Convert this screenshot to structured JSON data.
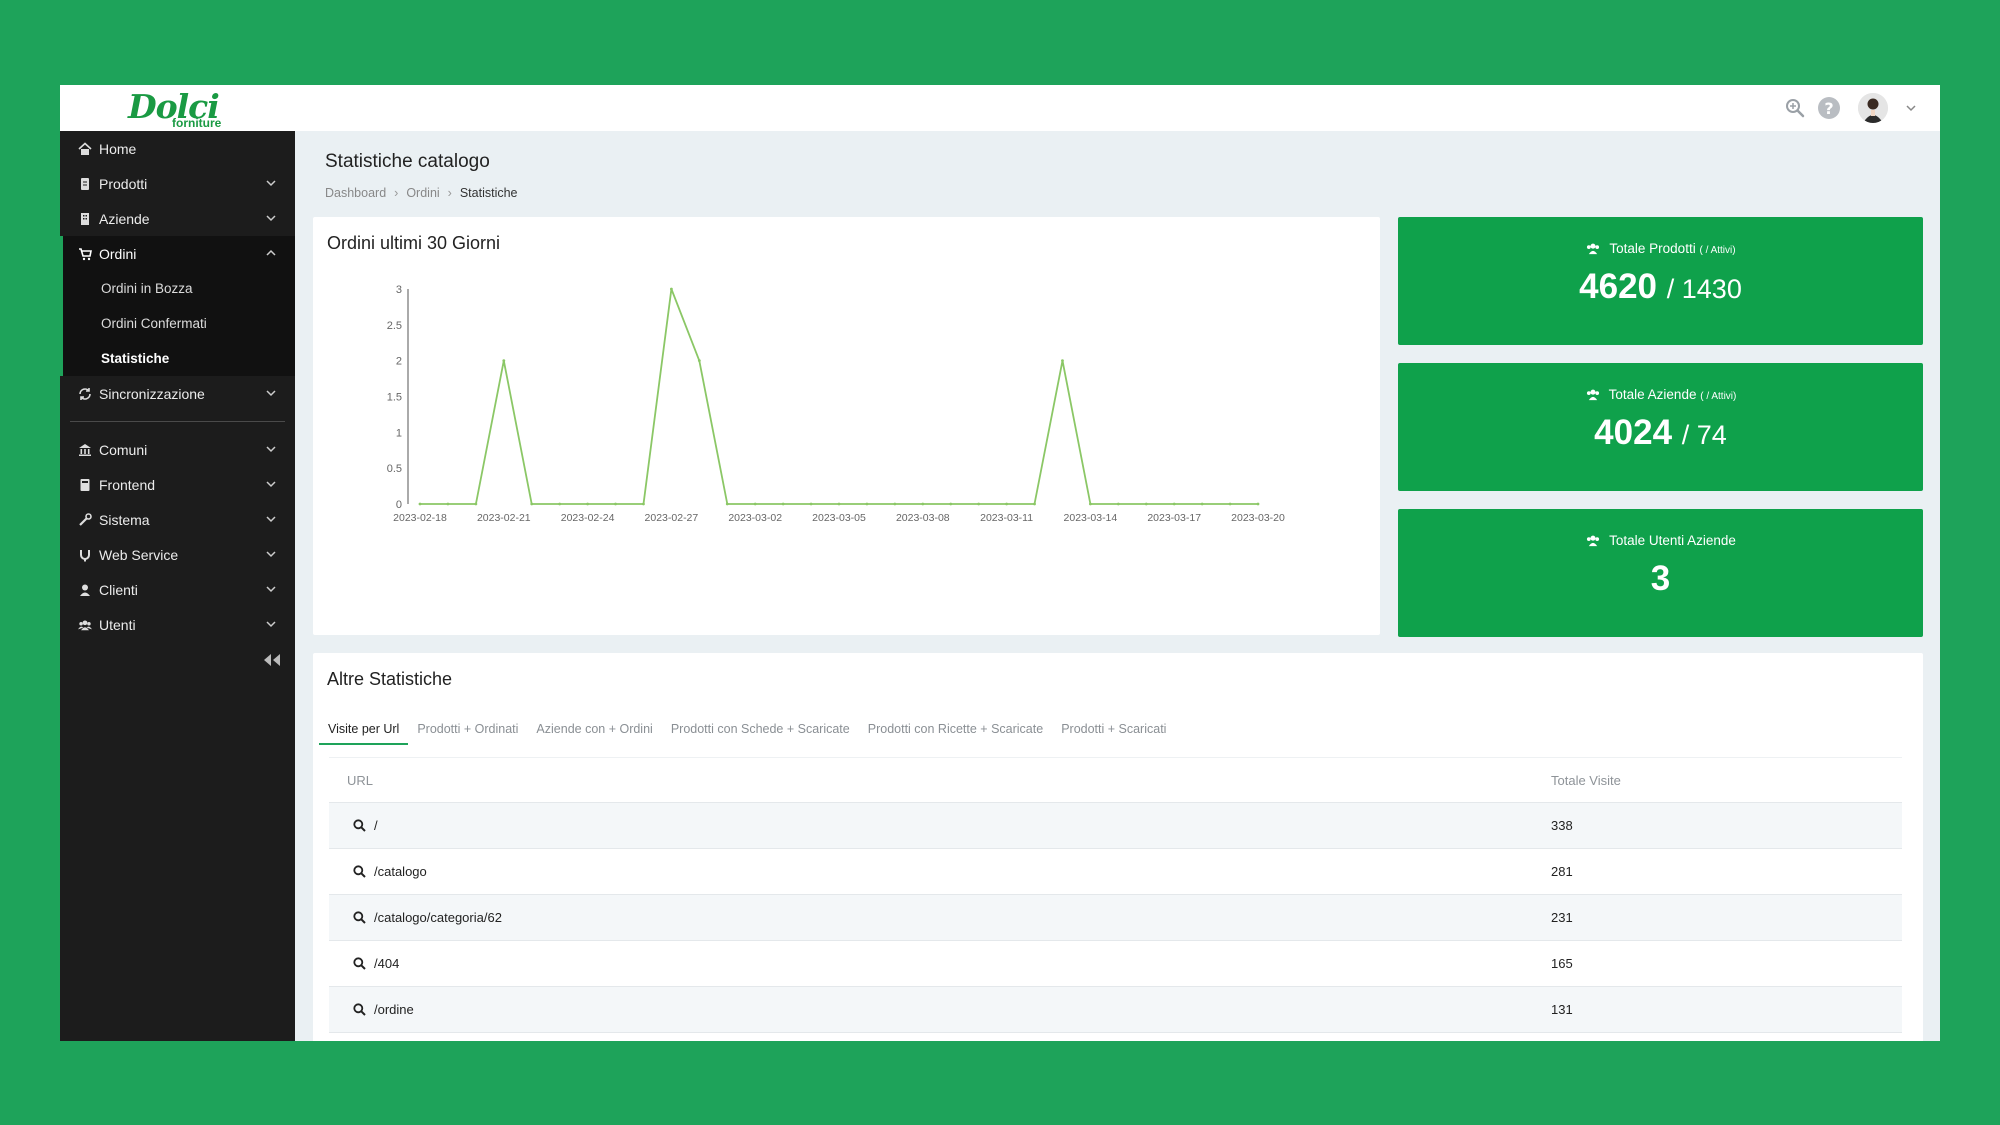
{
  "brand": {
    "logo_main": "Dolci",
    "logo_sub": "forniture",
    "color": "#1a9a43"
  },
  "topbar": {
    "icons": [
      "zoom-icon",
      "help-icon",
      "user-avatar",
      "chevron-down-icon"
    ],
    "help_glyph": "?"
  },
  "sidebar": {
    "items": [
      {
        "label": "Home",
        "icon": "home-icon"
      },
      {
        "label": "Prodotti",
        "icon": "file-icon",
        "has_children": true
      },
      {
        "label": "Aziende",
        "icon": "building-icon",
        "has_children": true
      },
      {
        "label": "Ordini",
        "icon": "cart-icon",
        "has_children": true,
        "expanded": true,
        "children": [
          {
            "label": "Ordini in Bozza"
          },
          {
            "label": "Ordini Confermati"
          },
          {
            "label": "Statistiche",
            "current": true
          }
        ]
      },
      {
        "label": "Sincronizzazione",
        "icon": "sync-icon",
        "has_children": true
      },
      {
        "label": "Comuni",
        "icon": "institution-icon",
        "has_children": true
      },
      {
        "label": "Frontend",
        "icon": "page-icon",
        "has_children": true
      },
      {
        "label": "Sistema",
        "icon": "wrench-icon",
        "has_children": true
      },
      {
        "label": "Web Service",
        "icon": "plug-icon",
        "has_children": true
      },
      {
        "label": "Clienti",
        "icon": "user-icon",
        "has_children": true
      },
      {
        "label": "Utenti",
        "icon": "users-icon",
        "has_children": true
      }
    ],
    "accent": "#1ea35a"
  },
  "page": {
    "title": "Statistiche catalogo",
    "breadcrumb": [
      "Dashboard",
      "Ordini",
      "Statistiche"
    ]
  },
  "chart_card": {
    "title": "Ordini ultimi 30 Giorni"
  },
  "chart_data": {
    "type": "line",
    "x": [
      "2023-02-18",
      "2023-02-19",
      "2023-02-20",
      "2023-02-21",
      "2023-02-22",
      "2023-02-23",
      "2023-02-24",
      "2023-02-25",
      "2023-02-26",
      "2023-02-27",
      "2023-02-28",
      "2023-03-01",
      "2023-03-02",
      "2023-03-03",
      "2023-03-04",
      "2023-03-05",
      "2023-03-06",
      "2023-03-07",
      "2023-03-08",
      "2023-03-09",
      "2023-03-10",
      "2023-03-11",
      "2023-03-12",
      "2023-03-13",
      "2023-03-14",
      "2023-03-15",
      "2023-03-16",
      "2023-03-17",
      "2023-03-18",
      "2023-03-19",
      "2023-03-20"
    ],
    "series": [
      {
        "values": [
          0,
          0,
          0,
          2,
          0,
          0,
          0,
          0,
          0,
          3,
          2,
          0,
          0,
          0,
          0,
          0,
          0,
          0,
          0,
          0,
          0,
          0,
          0,
          2,
          0,
          0,
          0,
          0,
          0,
          0,
          0
        ],
        "color": "#8bc766"
      }
    ],
    "xticks": [
      "2023-02-18",
      "2023-02-21",
      "2023-02-24",
      "2023-02-27",
      "2023-03-02",
      "2023-03-05",
      "2023-03-08",
      "2023-03-11",
      "2023-03-14",
      "2023-03-17",
      "2023-03-20"
    ],
    "yticks": [
      "0",
      "0.5",
      "1",
      "1.5",
      "2",
      "2.5",
      "3"
    ],
    "ylim": [
      0,
      3
    ],
    "grid": false
  },
  "stats": [
    {
      "label": "Totale Prodotti",
      "note": "( / Attivi)",
      "value": "4620",
      "second": "/ 1430",
      "icon": "users-icon"
    },
    {
      "label": "Totale Aziende",
      "note": "( / Attivi)",
      "value": "4024",
      "second": "/ 74",
      "icon": "users-icon"
    },
    {
      "label": "Totale Utenti Aziende",
      "note": "",
      "value": "3",
      "second": "",
      "icon": "users-icon"
    }
  ],
  "stat_color": "#0fa14b",
  "altre": {
    "title": "Altre Statistiche",
    "tabs": [
      "Visite per Url",
      "Prodotti + Ordinati",
      "Aziende con + Ordini",
      "Prodotti con Schede + Scaricate",
      "Prodotti con Ricette + Scaricate",
      "Prodotti + Scaricati"
    ],
    "active_tab": 0,
    "columns": [
      "URL",
      "Totale Visite"
    ],
    "rows": [
      {
        "url": "/",
        "visits": "338"
      },
      {
        "url": "/catalogo",
        "visits": "281"
      },
      {
        "url": "/catalogo/categoria/62",
        "visits": "231"
      },
      {
        "url": "/404",
        "visits": "165"
      },
      {
        "url": "/ordine",
        "visits": "131"
      }
    ]
  }
}
